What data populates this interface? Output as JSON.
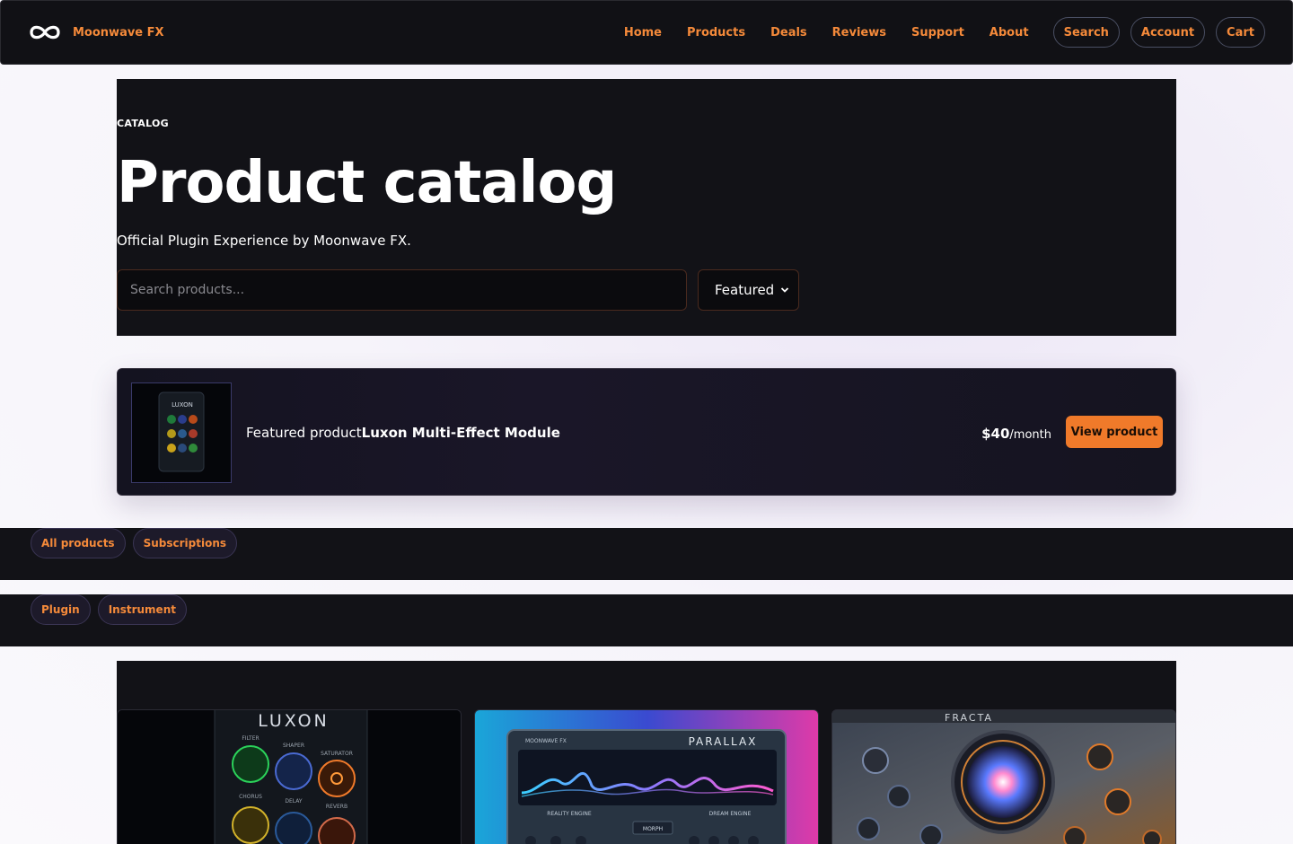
{
  "nav": {
    "brand": "Moonwave FX",
    "links": [
      "Home",
      "Products",
      "Deals",
      "Reviews",
      "Support",
      "About"
    ],
    "pills": [
      "Search",
      "Account",
      "Cart"
    ]
  },
  "hero": {
    "eyebrow": "CATALOG",
    "title": "Product catalog",
    "subtitle": "Official Plugin Experience by Moonwave FX.",
    "search_placeholder": "Search products...",
    "sort_value": "Featured"
  },
  "featured": {
    "label": "Featured product",
    "name": "Luxon Multi-Effect Module",
    "price": "$40",
    "period": "/month",
    "button": "View product",
    "thumb_text": "LUXON"
  },
  "filters_primary": [
    "All products",
    "Subscriptions"
  ],
  "filters_secondary": [
    "Plugin",
    "Instrument"
  ],
  "products": [
    {
      "image_text": "LUXON",
      "labels": [
        "FILTER",
        "SHAPER",
        "SATURATOR",
        "CHORUS",
        "DELAY",
        "REVERB"
      ]
    },
    {
      "image_text": "PARALLAX",
      "brand": "MOONWAVE FX",
      "labels": [
        "REALITY ENGINE",
        "DREAM ENGINE",
        "MORPH"
      ]
    },
    {
      "image_text": "FRACTA"
    }
  ],
  "colors": {
    "accent": "#f58a3a",
    "button": "#f07a2a",
    "dark": "#121217"
  }
}
